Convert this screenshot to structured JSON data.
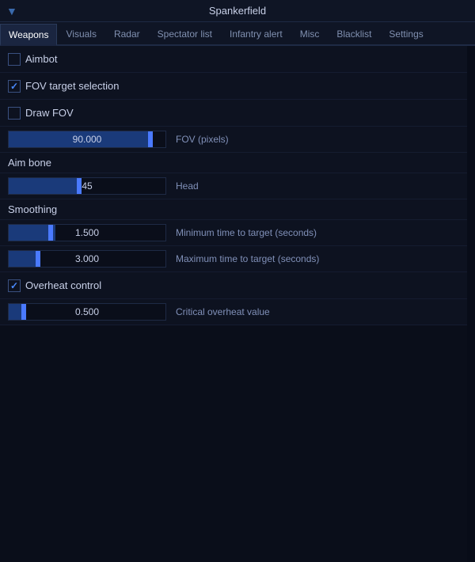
{
  "titleBar": {
    "arrow": "▼",
    "title": "Spankerfield"
  },
  "tabs": [
    {
      "label": "Weapons",
      "active": true
    },
    {
      "label": "Visuals",
      "active": false
    },
    {
      "label": "Radar",
      "active": false
    },
    {
      "label": "Spectator list",
      "active": false
    },
    {
      "label": "Infantry alert",
      "active": false
    },
    {
      "label": "Misc",
      "active": false
    },
    {
      "label": "Blacklist",
      "active": false
    },
    {
      "label": "Settings",
      "active": false
    }
  ],
  "sections": {
    "aimbot": {
      "label": "Aimbot",
      "checked": false
    },
    "fovTargetSelection": {
      "label": "FOV target selection",
      "checked": true
    },
    "drawFov": {
      "label": "Draw FOV",
      "checked": false
    },
    "fovPixels": {
      "value": "90.000",
      "label": "FOV (pixels)",
      "fillPercent": 90,
      "thumbPos": 176
    },
    "aimBone": {
      "sectionLabel": "Aim bone",
      "value": "45",
      "displayLabel": "Head",
      "fillPercent": 45,
      "thumbPos": 86
    },
    "smoothing": {
      "sectionLabel": "Smoothing",
      "minSlider": {
        "value": "1.500",
        "label": "Minimum time to target (seconds)",
        "fillPercent": 30,
        "thumbPos": 50
      },
      "maxSlider": {
        "value": "3.000",
        "label": "Maximum time to target (seconds)",
        "fillPercent": 20,
        "thumbPos": 34
      }
    },
    "overheatControl": {
      "label": "Overheat control",
      "checked": true
    },
    "criticalOverheat": {
      "value": "0.500",
      "label": "Critical overheat value",
      "fillPercent": 10,
      "thumbPos": 16
    }
  }
}
